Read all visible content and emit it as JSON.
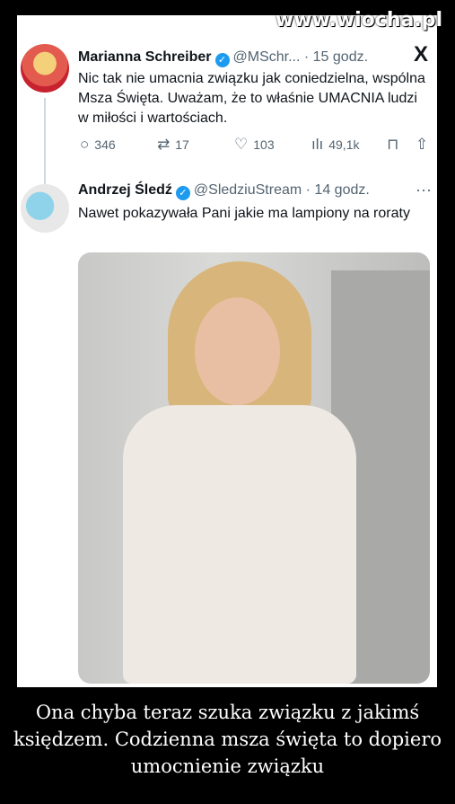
{
  "watermark": "www.wiocha.pl",
  "tweets": [
    {
      "name": "Marianna Schreiber",
      "handle": "@MSchr...",
      "time": "· 15 godz.",
      "text": "Nic tak nie umacnia związku jak coniedzielna, wspólna Msza Święta. Uważam, że to właśnie UMACNIA ludzi w miłości i wartościach.",
      "stats": {
        "replies": "346",
        "retweets": "17",
        "likes": "103",
        "views": "49,1k"
      }
    },
    {
      "name": "Andrzej Śledź",
      "handle": "@SledziuStream",
      "time": "· 14 godz.",
      "text": "Nawet pokazywała Pani jakie ma lampiony na roraty"
    }
  ],
  "icons": {
    "x_logo": "X",
    "more": "···",
    "verified": "✓",
    "reply": "○",
    "retweet": "⇄",
    "like": "♡",
    "views": "ılı",
    "bookmark": "⊓",
    "share": "⇧"
  },
  "caption": "Ona chyba teraz szuka związku z jakimś księdzem. Codzienna msza święta to dopiero umocnienie związku"
}
